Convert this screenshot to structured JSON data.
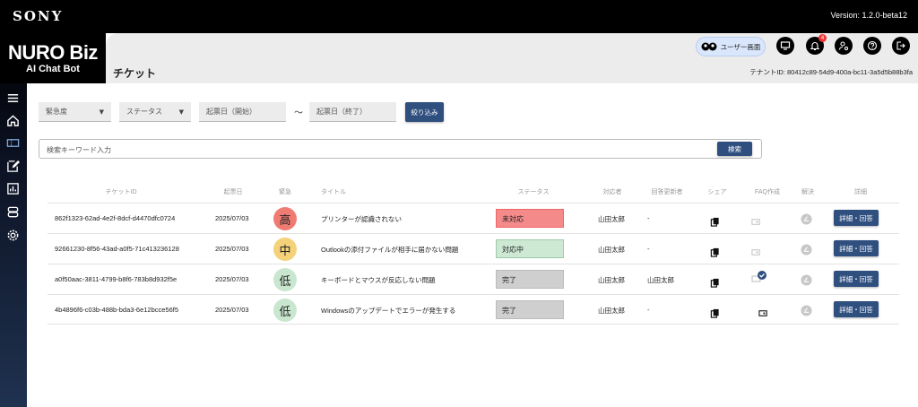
{
  "topbar": {
    "brand": "SONY",
    "version": "Version: 1.2.0-beta12"
  },
  "brand": {
    "logo": "NURO Biz",
    "subtitle": "AI Chat Bot"
  },
  "header": {
    "page_title": "チケット",
    "user_screen_label": "ユーザー画面",
    "tenant_id": "テナントID: 80412c89-54d9-400a-bc11-3a5d5b88b3fa",
    "notification_count": "4"
  },
  "filters": {
    "urgency_label": "緊急度",
    "status_label": "ステータス",
    "start_date_placeholder": "起票日（開始）",
    "tilde": "～",
    "end_date_placeholder": "起票日（終了）",
    "filter_button": "絞り込み"
  },
  "search": {
    "placeholder": "検索キーワード入力",
    "button": "検索"
  },
  "table": {
    "headers": {
      "ticket_id": "チケットID",
      "date": "起票日",
      "urgency": "緊急",
      "title": "タイトル",
      "status": "ステータス",
      "assignee": "対応者",
      "responder": "回答更新者",
      "share": "シェア",
      "faq": "FAQ作成",
      "resolve": "解決",
      "detail": "詳細"
    },
    "rows": [
      {
        "id": "862f1323-62ad-4e2f-8dcf-d4470dfc0724",
        "date": "2025/07/03",
        "urgency": "高",
        "title": "プリンターが認識されない",
        "status": "未対応",
        "assignee": "山田太郎",
        "responder": "-",
        "detail": "詳細・回答"
      },
      {
        "id": "92661230-8f56-43ad-a0f5-71c413236128",
        "date": "2025/07/03",
        "urgency": "中",
        "title": "Outlookの添付ファイルが相手に届かない問題",
        "status": "対応中",
        "assignee": "山田太郎",
        "responder": "-",
        "detail": "詳細・回答"
      },
      {
        "id": "a0f50aac-3811-4799-b8f6-783b8d932f5e",
        "date": "2025/07/03",
        "urgency": "低",
        "title": "キーボードとマウスが反応しない問題",
        "status": "完了",
        "assignee": "山田太郎",
        "responder": "山田太郎",
        "detail": "詳細・回答"
      },
      {
        "id": "4b4896f6-c03b-488b-bda3-6e12bcce56f5",
        "date": "2025/07/03",
        "urgency": "低",
        "title": "Windowsのアップデートでエラーが発生する",
        "status": "完了",
        "assignee": "山田太郎",
        "responder": "-",
        "detail": "詳細・回答"
      }
    ]
  },
  "colors": {
    "urgency_high": "#f07b72",
    "urgency_mid": "#f3d27a",
    "urgency_low": "#c9e6cf",
    "status_untouched": "#f48a8a",
    "status_inprogress": "#cde8d3",
    "status_done": "#cfcfcf",
    "primary": "#2f4f7f"
  }
}
